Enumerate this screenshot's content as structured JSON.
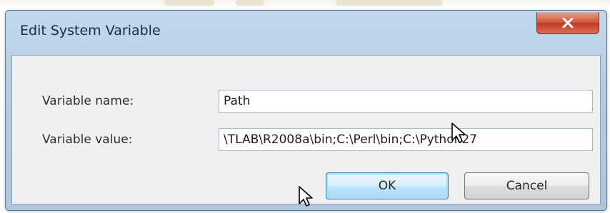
{
  "dialog": {
    "title": "Edit System Variable",
    "close_icon": "close-x-icon"
  },
  "fields": {
    "name_label": "Variable name:",
    "name_value": "Path",
    "value_label": "Variable value:",
    "value_value": "\\TLAB\\R2008a\\bin;C:\\Perl\\bin;C:\\Python27"
  },
  "buttons": {
    "ok_label": "OK",
    "cancel_label": "Cancel"
  },
  "cursors": [
    "arrow-cursor-icon",
    "arrow-cursor-icon"
  ],
  "colors": {
    "title_bar": "#b4cce3",
    "close_button": "#d3543a",
    "dialog_body": "#f0f0f0",
    "ok_focus": "#3c7fb1"
  }
}
